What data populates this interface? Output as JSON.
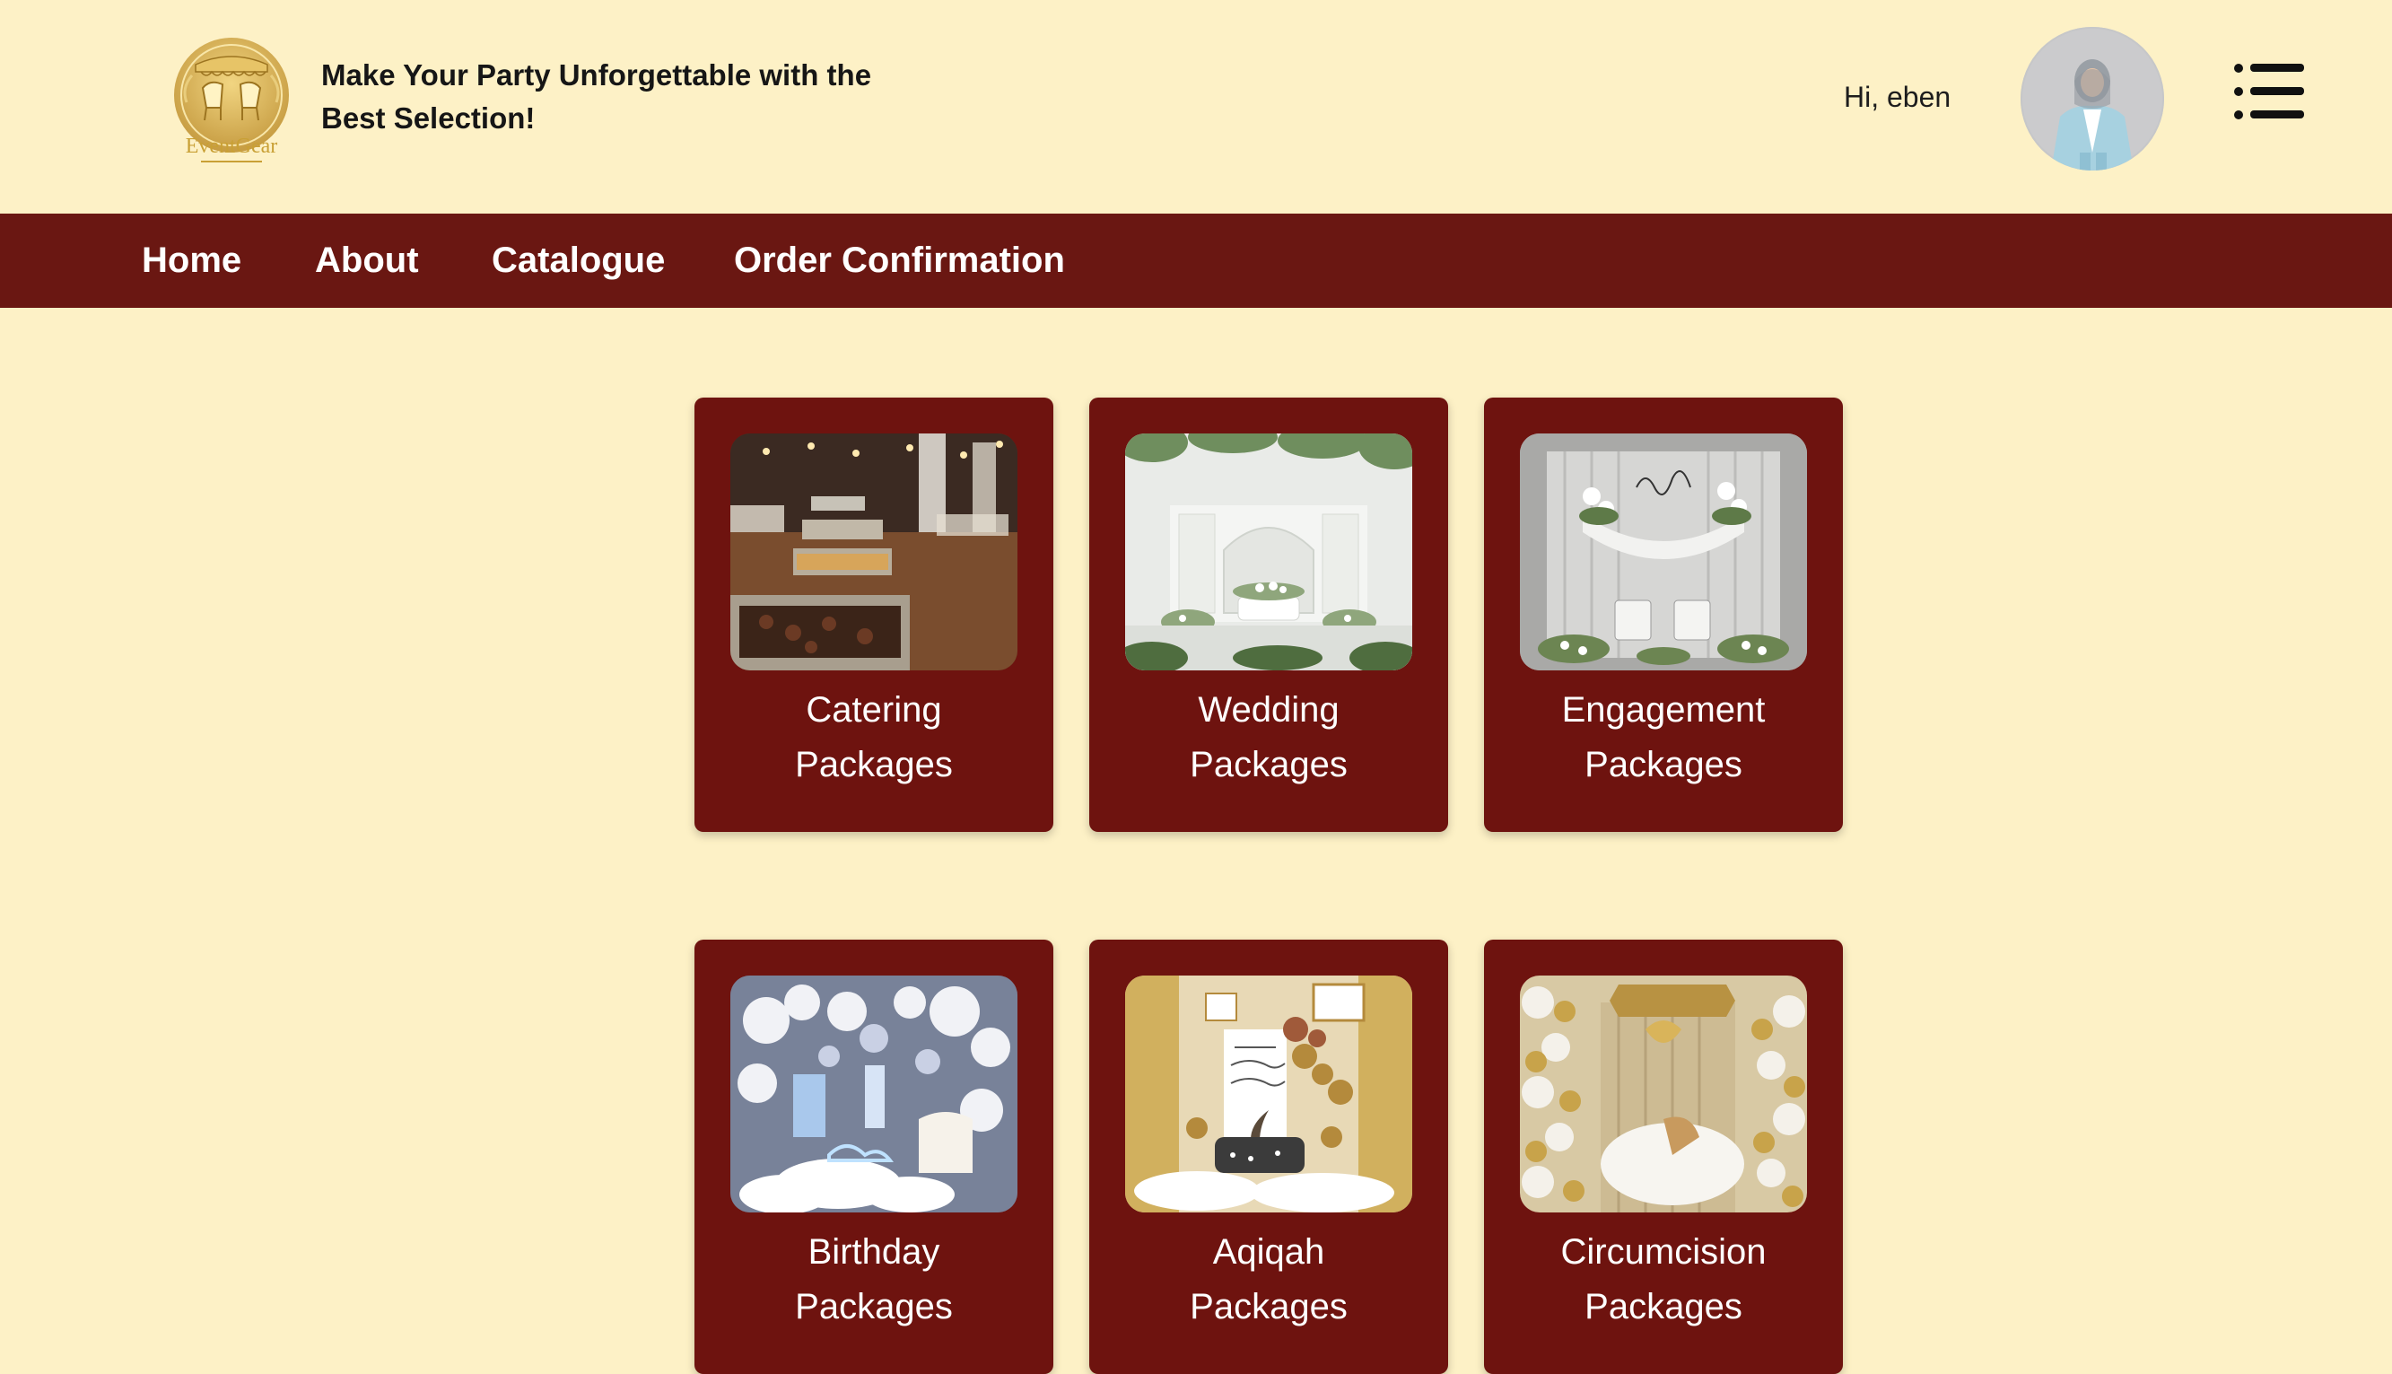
{
  "header": {
    "logo_text": "EventGear",
    "tagline_line1": "Make Your Party Unforgettable with the",
    "tagline_line2": "Best Selection!",
    "greeting": "Hi, eben",
    "avatar_icon": "user-avatar",
    "menu_icon": "list-menu-icon"
  },
  "nav": {
    "items": [
      {
        "label": "Home"
      },
      {
        "label": "About"
      },
      {
        "label": "Catalogue"
      },
      {
        "label": "Order Confirmation"
      }
    ]
  },
  "cards": [
    {
      "line1": "Catering",
      "line2": "Packages",
      "image": "catering-buffet-photo"
    },
    {
      "line1": "Wedding",
      "line2": "Packages",
      "image": "wedding-stage-photo"
    },
    {
      "line1": "Engagement",
      "line2": "Packages",
      "image": "engagement-decor-photo"
    },
    {
      "line1": "Birthday",
      "line2": "Packages",
      "image": "birthday-decor-photo"
    },
    {
      "line1": "Aqiqah",
      "line2": "Packages",
      "image": "aqiqah-decor-photo"
    },
    {
      "line1": "Circumcision",
      "line2": "Packages",
      "image": "circumcision-decor-photo"
    }
  ],
  "colors": {
    "background": "#fdf1c6",
    "navbar": "#6a1712",
    "card": "#6e130f",
    "logo_gold": "#c9a035"
  }
}
